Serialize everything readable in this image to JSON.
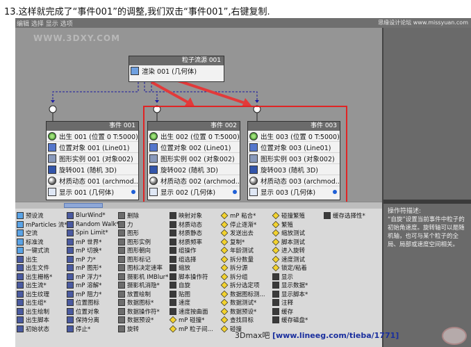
{
  "caption": "13.这样就完成了“事件001”的调整,我们双击“事件001”,右键复制.",
  "topbar": {
    "menu": "编辑   选择   显示   选项",
    "site": "思缘设计论坛  www.missyuan.com"
  },
  "watermark": "WWW.3DXY.COM",
  "source_node": {
    "title": "粒子流源 001",
    "row": "渲染 001 (几何体)"
  },
  "events": [
    {
      "title": "事件 001",
      "rows": [
        "出生 001 (位置 0 T:5000)",
        "位置对象 001 (Line01)",
        "图形实例 001 (对象002)",
        "旋转001 (随机 3D)",
        "材质动态 001 (archmod...",
        "显示 001 (几何体)"
      ]
    },
    {
      "title": "事件 002",
      "rows": [
        "出生 002 (位置 0 T:5000)",
        "位置对象 002 (Line01)",
        "图形实例 002 (对象002)",
        "旋转002 (随机 3D)",
        "材质动态 002 (archmod...",
        "显示 002 (几何体)"
      ]
    },
    {
      "title": "事件 003",
      "rows": [
        "出生 003 (位置 0 T:5000)",
        "位置对象 003 (Line01)",
        "图形实例 003 (对象002)",
        "旋转003 (随机 3D)",
        "材质动态 003 (archmod...",
        "显示 003 (几何体)"
      ]
    }
  ],
  "depot": {
    "col1": [
      "预设流",
      "mParticles 流*",
      "空流",
      "标准流",
      "一键式流",
      "出生",
      "出生文件",
      "出生栅格*",
      "出生流*",
      "出生纹理",
      "出生组*",
      "出生绘制",
      "出生脚本",
      "初始状态"
    ],
    "col2": [
      "BlurWind*",
      "Random Walk*",
      "Spin Limit*",
      "mP 世界*",
      "mP 切换*",
      "mP 力*",
      "mP 图形*",
      "mP 浮力*",
      "mP 溶解*",
      "mP 阻力*",
      "位置图标",
      "位置对象",
      "保持分离",
      "停止*"
    ],
    "col3": [
      "删除",
      "力",
      "图形",
      "图形实例",
      "图形朝向",
      "图形标记",
      "图标决定速率",
      "摄影机 IMBlur*",
      "摄影机消隐*",
      "放置绘制",
      "数据图标*",
      "数据操作符*",
      "数据预设*",
      "旋转"
    ],
    "col4": [
      "映射对象",
      "材质动态",
      "材质静态",
      "材质频率",
      "组操作",
      "组选择",
      "缩放",
      "脚本操作符",
      "自旋",
      "贴图",
      "速度",
      "速度按曲面",
      "mP 碰撞*",
      "mP 粒子间..."
    ],
    "col5": [
      "mP 粘合*",
      "停止逐渐*",
      "发送出去",
      "复制*",
      "年龄测试",
      "拆分数量",
      "拆分源",
      "拆分组",
      "拆分选定项",
      "数据图标测...",
      "数据测试*",
      "数据预设*",
      "查找目标",
      "碰撞"
    ],
    "col6": [
      "碰撞繁殖",
      "繁殖",
      "缩放测试",
      "脚本测试",
      "进入旋转",
      "速度测试",
      "锁定/粘着",
      "显示",
      "显示数据*",
      "显示脚本*",
      "注释",
      "缓存",
      "缓存磁盘*"
    ],
    "col7": [
      "缓存选择性*"
    ]
  },
  "right_panel": {
    "heading": "操作符描述:",
    "description": "“自旋”设置当前事件中粒子的初始角速度。旋转轴可以是随机轴，也可与某个粒子的全局、局部或速度空间相关。"
  },
  "footer": {
    "prefix": "3Dmax吧  ",
    "url": "[www.lineeg.com/tieba/1771]"
  }
}
